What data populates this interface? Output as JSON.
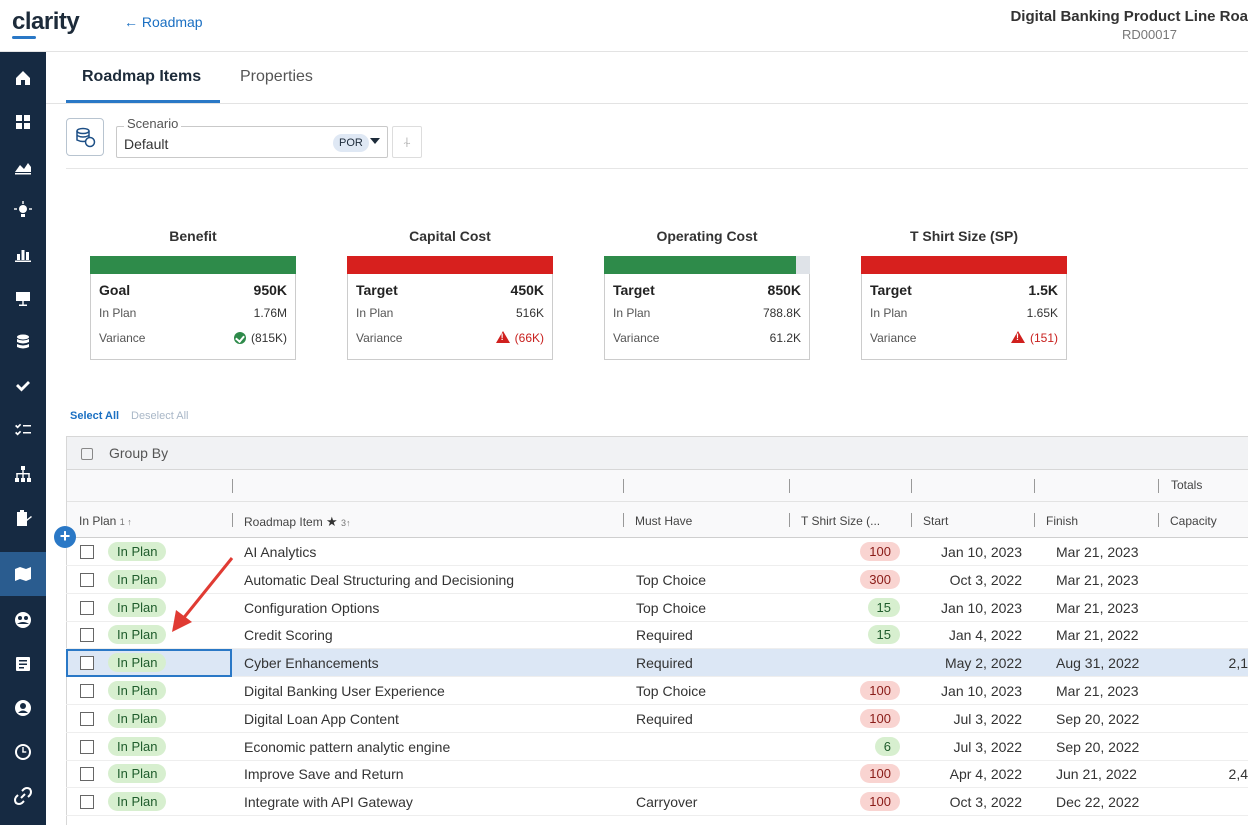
{
  "app": {
    "logo": "clarity",
    "back_label": "← Roadmap",
    "title": "Digital Banking Product Line Roa",
    "id": "RD00017"
  },
  "sidebar": {
    "icons": [
      "home-icon",
      "dashboard-icon",
      "chart-area-icon",
      "lightbulb-icon",
      "bar-chart-icon",
      "presentation-icon",
      "database-icon",
      "check-icon",
      "checklist-icon",
      "hierarchy-icon",
      "clipboard-icon",
      "roadmap-icon",
      "team-icon",
      "form-icon",
      "staffing-icon",
      "clock-icon",
      "link-icon"
    ],
    "active_index": 11
  },
  "tabs": [
    {
      "label": "Roadmap Items",
      "active": true
    },
    {
      "label": "Properties",
      "active": false
    }
  ],
  "scenario": {
    "label": "Scenario",
    "value": "Default",
    "badge": "POR"
  },
  "kpis": [
    {
      "title": "Benefit",
      "bar_color": "#2e8b4a",
      "bar_fill": 1.0,
      "label1": "Goal",
      "value1": "950K",
      "label2": "In Plan",
      "value2": "1.76M",
      "label3": "Variance",
      "value3": "(815K)",
      "status": "ok"
    },
    {
      "title": "Capital Cost",
      "bar_color": "#d7201e",
      "bar_fill": 1.0,
      "label1": "Target",
      "value1": "450K",
      "label2": "In Plan",
      "value2": "516K",
      "label3": "Variance",
      "value3": "(66K)",
      "status": "warn"
    },
    {
      "title": "Operating Cost",
      "bar_color": "#2e8b4a",
      "bar_fill": 0.93,
      "label1": "Target",
      "value1": "850K",
      "label2": "In Plan",
      "value2": "788.8K",
      "label3": "Variance",
      "value3": "61.2K",
      "status": "none"
    },
    {
      "title": "T Shirt Size (SP)",
      "bar_color": "#d7201e",
      "bar_fill": 1.0,
      "label1": "Target",
      "value1": "1.5K",
      "label2": "In Plan",
      "value2": "1.65K",
      "label3": "Variance",
      "value3": "(151)",
      "status": "warn"
    }
  ],
  "selection": {
    "select_all": "Select All",
    "deselect_all": "Deselect All"
  },
  "grid": {
    "group_by": "Group By",
    "totals_label": "Totals",
    "columns": {
      "in_plan": "In Plan",
      "in_plan_sort": "1 ↑",
      "item": "Roadmap Item",
      "item_star": "★",
      "item_sort": "3↑",
      "must_have": "Must Have",
      "tshirt": "T Shirt Size (...",
      "start": "Start",
      "finish": "Finish",
      "capacity": "Capacity"
    },
    "rows": [
      {
        "status": "In Plan",
        "name": "AI Analytics",
        "must": "",
        "size": "100",
        "size_color": "red",
        "start": "Jan 10, 2023",
        "finish": "Mar 21, 2023",
        "capacity": ""
      },
      {
        "status": "In Plan",
        "name": "Automatic Deal Structuring and Decisioning",
        "must": "Top Choice",
        "size": "300",
        "size_color": "red",
        "start": "Oct 3, 2022",
        "finish": "Mar 21, 2023",
        "capacity": ""
      },
      {
        "status": "In Plan",
        "name": "Configuration Options",
        "must": "Top Choice",
        "size": "15",
        "size_color": "green",
        "start": "Jan 10, 2023",
        "finish": "Mar 21, 2023",
        "capacity": ""
      },
      {
        "status": "In Plan",
        "name": "Credit Scoring",
        "must": "Required",
        "size": "15",
        "size_color": "green",
        "start": "Jan 4, 2022",
        "finish": "Mar 21, 2022",
        "capacity": ""
      },
      {
        "status": "In Plan",
        "name": "Cyber Enhancements",
        "must": "Required",
        "size": "",
        "size_color": "",
        "start": "May 2, 2022",
        "finish": "Aug 31, 2022",
        "capacity": "2,1",
        "selected": true
      },
      {
        "status": "In Plan",
        "name": "Digital Banking User Experience",
        "must": "Top Choice",
        "size": "100",
        "size_color": "red",
        "start": "Jan 10, 2023",
        "finish": "Mar 21, 2023",
        "capacity": ""
      },
      {
        "status": "In Plan",
        "name": "Digital Loan App Content",
        "must": "Required",
        "size": "100",
        "size_color": "red",
        "start": "Jul 3, 2022",
        "finish": "Sep 20, 2022",
        "capacity": ""
      },
      {
        "status": "In Plan",
        "name": "Economic pattern analytic engine",
        "must": "",
        "size": "6",
        "size_color": "green",
        "start": "Jul 3, 2022",
        "finish": "Sep 20, 2022",
        "capacity": ""
      },
      {
        "status": "In Plan",
        "name": "Improve Save and Return",
        "must": "",
        "size": "100",
        "size_color": "red",
        "start": "Apr 4, 2022",
        "finish": "Jun 21, 2022",
        "capacity": "2,4"
      },
      {
        "status": "In Plan",
        "name": "Integrate with API Gateway",
        "must": "Carryover",
        "size": "100",
        "size_color": "red",
        "start": "Oct 3, 2022",
        "finish": "Dec 22, 2022",
        "capacity": ""
      }
    ]
  }
}
